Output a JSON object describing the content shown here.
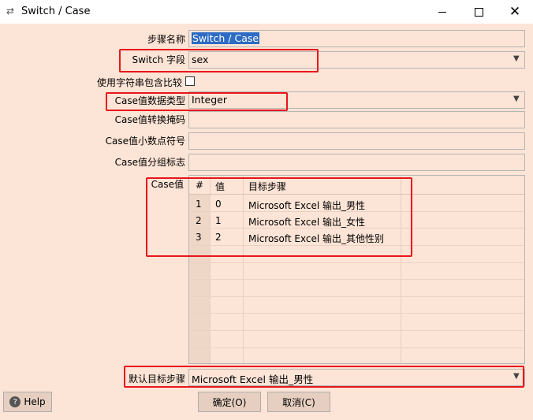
{
  "window": {
    "title": "Switch / Case",
    "app_icon": "arrows-swap-icon"
  },
  "form": {
    "step_name_label": "步骤名称",
    "step_name_value": "Switch / Case",
    "switch_field_label": "Switch 字段",
    "switch_field_value": "sex",
    "use_contains_label": "使用字符串包含比较",
    "use_contains_checked": false,
    "case_type_label": "Case值数据类型",
    "case_type_value": "Integer",
    "case_mask_label": "Case值转换掩码",
    "case_mask_value": "",
    "case_decimal_label": "Case值小数点符号",
    "case_decimal_value": "",
    "case_group_label": "Case值分组标志",
    "case_group_value": "",
    "case_values_label": "Case值",
    "default_target_label": "默认目标步骤",
    "default_target_value": "Microsoft Excel 输出_男性"
  },
  "table": {
    "headers": [
      "#",
      "值",
      "目标步骤"
    ],
    "rows": [
      {
        "num": "1",
        "value": "0",
        "target": "Microsoft Excel 输出_男性"
      },
      {
        "num": "2",
        "value": "1",
        "target": "Microsoft Excel 输出_女性"
      },
      {
        "num": "3",
        "value": "2",
        "target": "Microsoft Excel 输出_其他性别"
      }
    ]
  },
  "buttons": {
    "help": "Help",
    "ok": "确定(O)",
    "cancel": "取消(C)"
  },
  "colors": {
    "background": "#fce4d6",
    "highlight_box": "#e8161b",
    "selection": "#2d6bc4"
  }
}
